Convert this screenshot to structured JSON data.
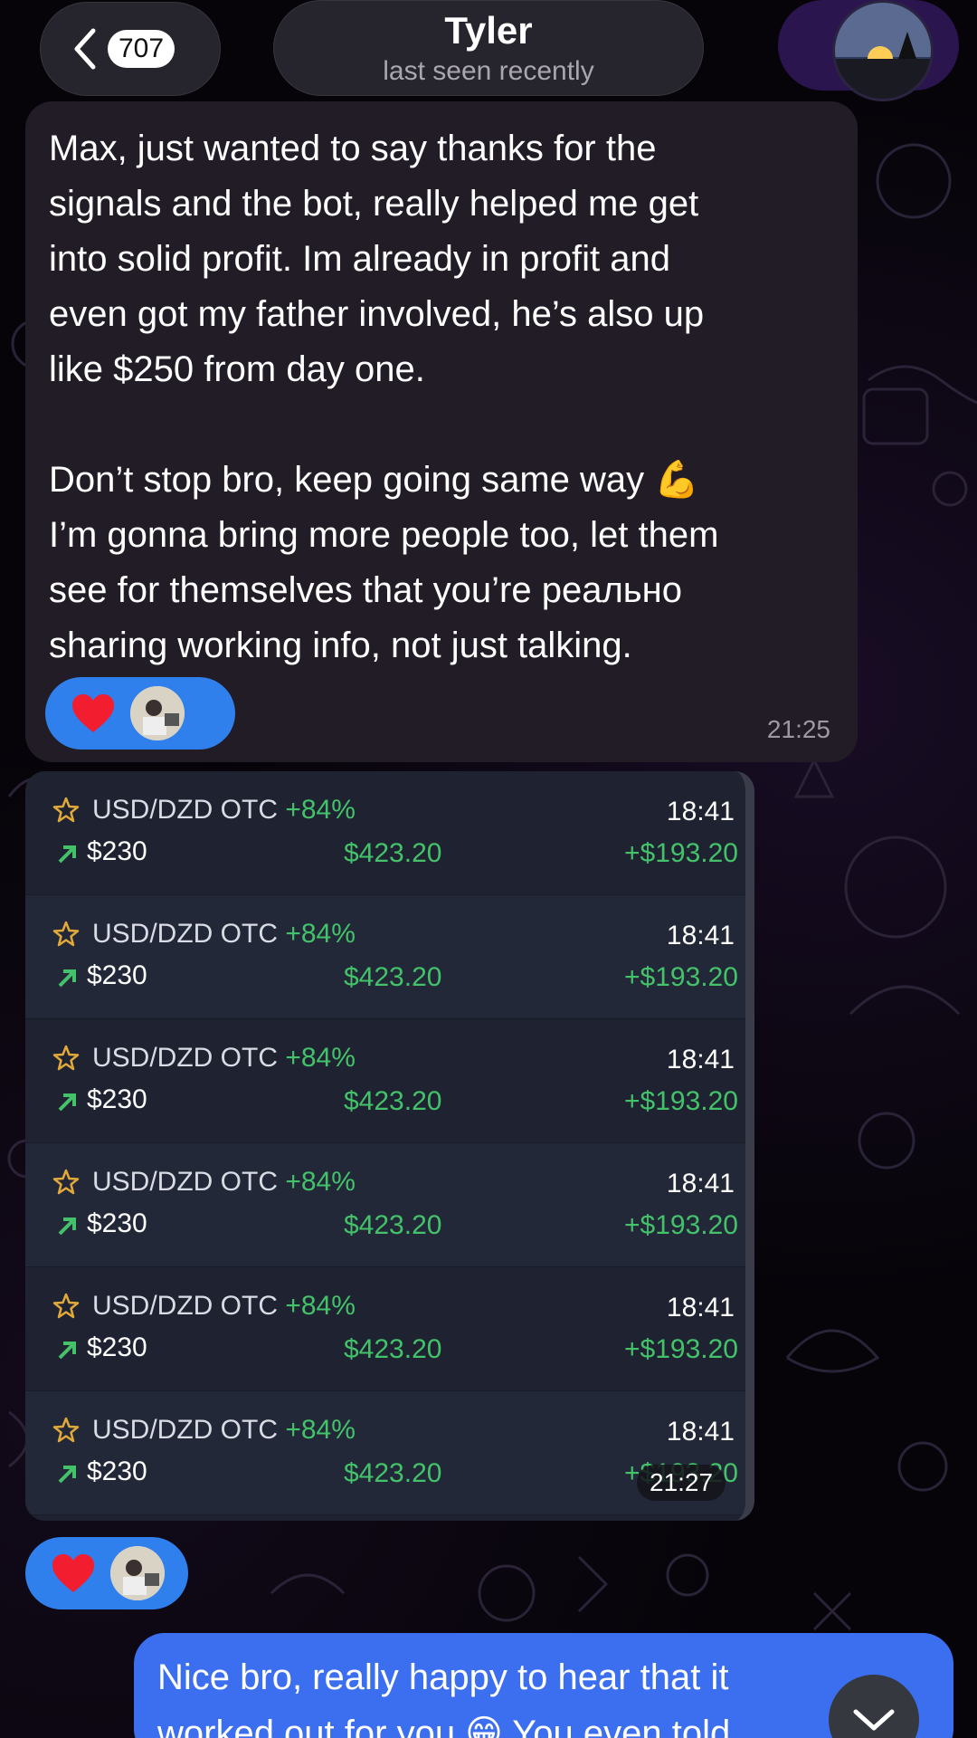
{
  "header": {
    "unread_count": "707",
    "contact_name": "Tyler",
    "contact_status": "last seen recently"
  },
  "messages": {
    "incoming": {
      "text": "Max, just wanted to say thanks for the\nsignals and the bot, really helped me get\ninto solid profit. Im already in profit and\neven got my father involved, he’s also up\nlike $250 from day one.\n\nDon’t stop bro, keep going same way 💪\nI’m gonna bring more people too, let them\nsee for themselves that you’re реально\nsharing working info, not just talking.",
      "reaction_icon": "heart-icon",
      "time": "21:25"
    },
    "screenshot": {
      "time": "21:27",
      "reaction_icon": "heart-icon",
      "trades": [
        {
          "pair": "USD/DZD OTC",
          "pct": "+84%",
          "amount": "$230",
          "payout": "$423.20",
          "time": "18:41",
          "profit": "+$193.20"
        },
        {
          "pair": "USD/DZD OTC",
          "pct": "+84%",
          "amount": "$230",
          "payout": "$423.20",
          "time": "18:41",
          "profit": "+$193.20"
        },
        {
          "pair": "USD/DZD OTC",
          "pct": "+84%",
          "amount": "$230",
          "payout": "$423.20",
          "time": "18:41",
          "profit": "+$193.20"
        },
        {
          "pair": "USD/DZD OTC",
          "pct": "+84%",
          "amount": "$230",
          "payout": "$423.20",
          "time": "18:41",
          "profit": "+$193.20"
        },
        {
          "pair": "USD/DZD OTC",
          "pct": "+84%",
          "amount": "$230",
          "payout": "$423.20",
          "time": "18:41",
          "profit": "+$193.20"
        },
        {
          "pair": "USD/DZD OTC",
          "pct": "+84%",
          "amount": "$230",
          "payout": "$423.20",
          "time": "18:41",
          "profit": "+$193.20"
        }
      ]
    },
    "outgoing": {
      "text": "Nice bro, really happy to hear that it\nworked out for you 😁 You even told"
    }
  },
  "colors": {
    "incoming_bubble": "#211c26",
    "outgoing_bubble": "#3c6ff0",
    "reaction_bg": "#2f80ed",
    "profit_green": "#43c26a"
  }
}
